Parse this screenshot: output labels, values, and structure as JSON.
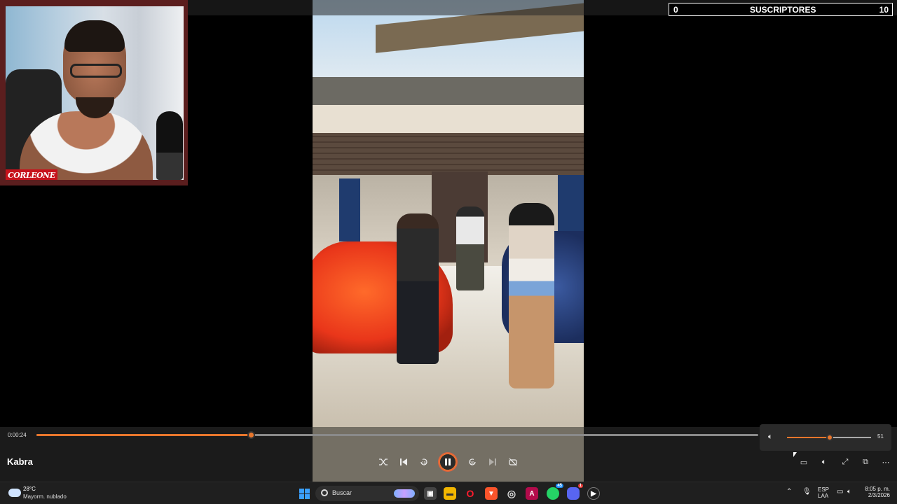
{
  "overlay": {
    "subscribers": {
      "current": "0",
      "label": "SUSCRIPTORES",
      "goal": "10"
    },
    "webcam_logo": "CORLEONE"
  },
  "player": {
    "current_time": "0:00:24",
    "progress_fraction": 0.297,
    "title": "Kabra",
    "volume": {
      "value": "51",
      "fraction": 0.51
    },
    "accent_color": "#e8762c"
  },
  "taskbar": {
    "weather": {
      "temp": "28°C",
      "desc": "Mayorm. nublado"
    },
    "search_placeholder": "Buscar",
    "language_top": "ESP",
    "language_bottom": "LAA",
    "time": "8:05 p. m.",
    "date": "2/3/2026",
    "whatsapp_badge": "45",
    "discord_badge": "1"
  }
}
